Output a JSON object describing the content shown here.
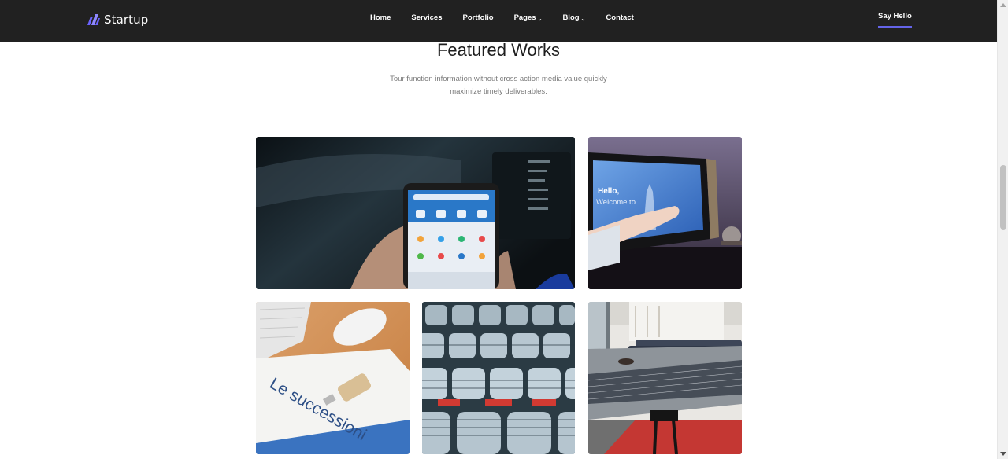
{
  "brand": {
    "name": "Startup",
    "icon": "startup-logo-icon",
    "accent": "#6464e8"
  },
  "nav": {
    "items": [
      {
        "label": "Home",
        "dropdown": false
      },
      {
        "label": "Services",
        "dropdown": false
      },
      {
        "label": "Portfolio",
        "dropdown": false
      },
      {
        "label": "Pages",
        "dropdown": true
      },
      {
        "label": "Blog",
        "dropdown": true
      },
      {
        "label": "Contact",
        "dropdown": false
      }
    ],
    "cta": "Say Hello",
    "background": "#212121"
  },
  "featured": {
    "title": "Featured Works",
    "subtitle": "Tour function information without cross action media value quickly maximize timely deliverables.",
    "works": [
      {
        "name": "phone-payment-app-photo"
      },
      {
        "name": "tablet-welcome-screen-photo"
      },
      {
        "name": "usb-book-le-successioni-photo"
      },
      {
        "name": "auditorium-chairs-photo"
      },
      {
        "name": "ping-pong-table-photo"
      }
    ],
    "image_text": {
      "tablet_greeting": "Hello,",
      "tablet_welcome": "Welcome to",
      "book_title": "Le successioni"
    }
  }
}
